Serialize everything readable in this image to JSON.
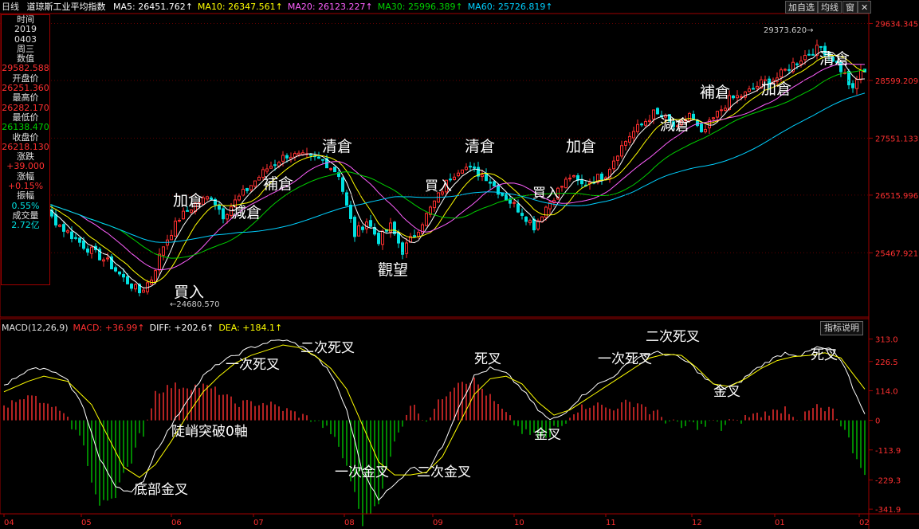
{
  "header": {
    "period": "日线",
    "index_name": "道琼斯工业平均指数",
    "ma": [
      {
        "label": "MA5: 26451.762↑",
        "color": "#ffffff"
      },
      {
        "label": "MA10: 26347.561↑",
        "color": "#ffff00"
      },
      {
        "label": "MA20: 26123.227↑",
        "color": "#ff60ff"
      },
      {
        "label": "MA30: 25996.389↑",
        "color": "#00d000"
      },
      {
        "label": "MA60: 25726.819↑",
        "color": "#00d0ff"
      }
    ],
    "buttons": [
      "加自选",
      "均线",
      "窗",
      "✕"
    ]
  },
  "info_panel": [
    {
      "text": "时间",
      "cls": "w"
    },
    {
      "text": "2019",
      "cls": "w"
    },
    {
      "text": "0403",
      "cls": "w"
    },
    {
      "text": "周三",
      "cls": "w"
    },
    {
      "text": "数值",
      "cls": "w"
    },
    {
      "text": "29582.588",
      "cls": "r"
    },
    {
      "text": "开盘价",
      "cls": "w"
    },
    {
      "text": "26251.360",
      "cls": "r"
    },
    {
      "text": "最高价",
      "cls": "w"
    },
    {
      "text": "26282.170",
      "cls": "r"
    },
    {
      "text": "最低价",
      "cls": "w"
    },
    {
      "text": "26138.470",
      "cls": "g"
    },
    {
      "text": "收盘价",
      "cls": "w"
    },
    {
      "text": "26218.130",
      "cls": "r"
    },
    {
      "text": "涨跌",
      "cls": "w"
    },
    {
      "text": "+39.000",
      "cls": "r"
    },
    {
      "text": "涨幅",
      "cls": "w"
    },
    {
      "text": "+0.15%",
      "cls": "r"
    },
    {
      "text": "振幅",
      "cls": "w"
    },
    {
      "text": "0.55%",
      "cls": "c"
    },
    {
      "text": "成交量",
      "cls": "w"
    },
    {
      "text": "2.72亿",
      "cls": "c"
    }
  ],
  "macd_header": [
    {
      "label": "MACD(12,26,9)",
      "color": "#e0e0e0"
    },
    {
      "label": "MACD: +36.99↑",
      "color": "#ff3030"
    },
    {
      "label": "DIFF: +202.6↑",
      "color": "#ffffff"
    },
    {
      "label": "DEA: +184.1↑",
      "color": "#ffff00"
    }
  ],
  "macd_button": "指标说明",
  "chart_data": [
    {
      "type": "candlestick",
      "y_ticks": [
        29634.345,
        28599.209,
        27551.133,
        26515.996,
        25467.921
      ],
      "ylim": [
        24300,
        29800
      ],
      "x_month_labels": [
        "04",
        "05",
        "06",
        "07",
        "08",
        "09",
        "10",
        "11",
        "12",
        "01",
        "02"
      ],
      "price_anchors": [
        [
          0,
          26500
        ],
        [
          10,
          26250
        ],
        [
          15,
          25900
        ],
        [
          20,
          25600
        ],
        [
          26,
          25300
        ],
        [
          30,
          25000
        ],
        [
          34,
          24750
        ],
        [
          37,
          25000
        ],
        [
          40,
          25600
        ],
        [
          44,
          26100
        ],
        [
          48,
          26350
        ],
        [
          52,
          26500
        ],
        [
          55,
          26150
        ],
        [
          58,
          26400
        ],
        [
          62,
          26700
        ],
        [
          66,
          27000
        ],
        [
          71,
          27250
        ],
        [
          76,
          27200
        ],
        [
          80,
          27150
        ],
        [
          84,
          26900
        ],
        [
          86,
          26300
        ],
        [
          88,
          25800
        ],
        [
          91,
          26050
        ],
        [
          94,
          25700
        ],
        [
          97,
          25950
        ],
        [
          100,
          25500
        ],
        [
          103,
          25800
        ],
        [
          106,
          26150
        ],
        [
          109,
          26500
        ],
        [
          112,
          26850
        ],
        [
          115,
          27050
        ],
        [
          118,
          26950
        ],
        [
          121,
          26850
        ],
        [
          124,
          26600
        ],
        [
          127,
          26400
        ],
        [
          130,
          26200
        ],
        [
          133,
          25950
        ],
        [
          136,
          26300
        ],
        [
          139,
          26600
        ],
        [
          142,
          26850
        ],
        [
          145,
          26700
        ],
        [
          148,
          26800
        ],
        [
          151,
          26900
        ],
        [
          154,
          27300
        ],
        [
          157,
          27600
        ],
        [
          160,
          27800
        ],
        [
          163,
          28000
        ],
        [
          166,
          27900
        ],
        [
          169,
          27700
        ],
        [
          172,
          28000
        ],
        [
          175,
          27600
        ],
        [
          178,
          27900
        ],
        [
          182,
          28250
        ],
        [
          186,
          28350
        ],
        [
          190,
          28550
        ],
        [
          194,
          28650
        ],
        [
          198,
          28900
        ],
        [
          202,
          29100
        ],
        [
          205,
          29200
        ],
        [
          208,
          29000
        ],
        [
          211,
          28700
        ],
        [
          213,
          28400
        ],
        [
          215,
          28800
        ],
        [
          216,
          28700
        ]
      ],
      "annotations": [
        {
          "text": "加倉",
          "x": 217,
          "y": 258,
          "size": 19
        },
        {
          "text": "減倉",
          "x": 290,
          "y": 273,
          "size": 19
        },
        {
          "text": "補倉",
          "x": 330,
          "y": 237,
          "size": 19
        },
        {
          "text": "清倉",
          "x": 404,
          "y": 190,
          "size": 19
        },
        {
          "text": "買入",
          "x": 533,
          "y": 239,
          "size": 17
        },
        {
          "text": "觀望",
          "x": 474,
          "y": 345,
          "size": 19
        },
        {
          "text": "清倉",
          "x": 583,
          "y": 190,
          "size": 19
        },
        {
          "text": "加倉",
          "x": 710,
          "y": 190,
          "size": 19
        },
        {
          "text": "買入",
          "x": 668,
          "y": 248,
          "size": 17
        },
        {
          "text": "補倉",
          "x": 878,
          "y": 122,
          "size": 19
        },
        {
          "text": "減倉",
          "x": 828,
          "y": 163,
          "size": 19
        },
        {
          "text": "加倉",
          "x": 955,
          "y": 118,
          "size": 19
        },
        {
          "text": "清倉",
          "x": 1028,
          "y": 80,
          "size": 19
        },
        {
          "text": "買入",
          "x": 218,
          "y": 373,
          "size": 19
        }
      ],
      "peak_label": "29373.620",
      "trough_label": "24680.570"
    },
    {
      "type": "macd",
      "y_ticks": [
        "313.0",
        "226.5",
        "114.0",
        "0",
        "-113.9",
        "-229.3",
        "-341.9"
      ],
      "y_tick_values": [
        313.0,
        226.5,
        114.0,
        0,
        -113.9,
        -229.3,
        -341.9
      ],
      "ylim": [
        -360,
        330
      ],
      "diff_anchors": [
        [
          0,
          130
        ],
        [
          4,
          180
        ],
        [
          8,
          200
        ],
        [
          12,
          190
        ],
        [
          16,
          150
        ],
        [
          20,
          50
        ],
        [
          24,
          -150
        ],
        [
          28,
          -250
        ],
        [
          32,
          -280
        ],
        [
          35,
          -230
        ],
        [
          38,
          -120
        ],
        [
          42,
          -20
        ],
        [
          46,
          80
        ],
        [
          50,
          170
        ],
        [
          54,
          220
        ],
        [
          58,
          250
        ],
        [
          62,
          280
        ],
        [
          66,
          300
        ],
        [
          70,
          310
        ],
        [
          74,
          290
        ],
        [
          78,
          250
        ],
        [
          82,
          180
        ],
        [
          86,
          40
        ],
        [
          90,
          -200
        ],
        [
          94,
          -300
        ],
        [
          98,
          -250
        ],
        [
          102,
          -180
        ],
        [
          106,
          -200
        ],
        [
          110,
          -100
        ],
        [
          114,
          50
        ],
        [
          118,
          170
        ],
        [
          122,
          200
        ],
        [
          126,
          180
        ],
        [
          130,
          120
        ],
        [
          134,
          40
        ],
        [
          137,
          0
        ],
        [
          140,
          20
        ],
        [
          144,
          80
        ],
        [
          148,
          130
        ],
        [
          152,
          160
        ],
        [
          156,
          210
        ],
        [
          160,
          250
        ],
        [
          164,
          260
        ],
        [
          168,
          250
        ],
        [
          172,
          220
        ],
        [
          176,
          160
        ],
        [
          180,
          120
        ],
        [
          184,
          140
        ],
        [
          188,
          190
        ],
        [
          192,
          230
        ],
        [
          196,
          260
        ],
        [
          200,
          250
        ],
        [
          204,
          280
        ],
        [
          208,
          270
        ],
        [
          211,
          200
        ],
        [
          214,
          90
        ],
        [
          216,
          30
        ]
      ],
      "dea_anchors": [
        [
          0,
          110
        ],
        [
          6,
          150
        ],
        [
          10,
          170
        ],
        [
          16,
          150
        ],
        [
          22,
          60
        ],
        [
          26,
          -60
        ],
        [
          30,
          -180
        ],
        [
          34,
          -220
        ],
        [
          38,
          -170
        ],
        [
          42,
          -80
        ],
        [
          46,
          20
        ],
        [
          50,
          110
        ],
        [
          54,
          170
        ],
        [
          58,
          220
        ],
        [
          62,
          250
        ],
        [
          66,
          270
        ],
        [
          70,
          290
        ],
        [
          74,
          280
        ],
        [
          78,
          250
        ],
        [
          82,
          200
        ],
        [
          86,
          120
        ],
        [
          90,
          -20
        ],
        [
          94,
          -160
        ],
        [
          98,
          -210
        ],
        [
          102,
          -210
        ],
        [
          106,
          -200
        ],
        [
          110,
          -140
        ],
        [
          114,
          -20
        ],
        [
          118,
          100
        ],
        [
          122,
          160
        ],
        [
          126,
          170
        ],
        [
          130,
          140
        ],
        [
          134,
          70
        ],
        [
          138,
          20
        ],
        [
          142,
          40
        ],
        [
          146,
          80
        ],
        [
          150,
          120
        ],
        [
          154,
          160
        ],
        [
          158,
          200
        ],
        [
          162,
          240
        ],
        [
          166,
          255
        ],
        [
          170,
          250
        ],
        [
          174,
          200
        ],
        [
          178,
          140
        ],
        [
          182,
          130
        ],
        [
          186,
          160
        ],
        [
          190,
          200
        ],
        [
          194,
          230
        ],
        [
          198,
          245
        ],
        [
          202,
          250
        ],
        [
          206,
          260
        ],
        [
          210,
          240
        ],
        [
          213,
          180
        ],
        [
          216,
          120
        ]
      ],
      "annotations": [
        {
          "text": "一次死叉",
          "x": 283,
          "y": 463,
          "size": 17
        },
        {
          "text": "二次死叉",
          "x": 377,
          "y": 442,
          "size": 17
        },
        {
          "text": "陡峭突破0軸",
          "x": 215,
          "y": 547,
          "size": 17
        },
        {
          "text": "底部金叉",
          "x": 168,
          "y": 620,
          "size": 17
        },
        {
          "text": "一次金叉",
          "x": 420,
          "y": 598,
          "size": 17
        },
        {
          "text": "二次金叉",
          "x": 523,
          "y": 598,
          "size": 17
        },
        {
          "text": "死叉",
          "x": 595,
          "y": 456,
          "size": 17
        },
        {
          "text": "金叉",
          "x": 670,
          "y": 551,
          "size": 17
        },
        {
          "text": "一次死叉",
          "x": 750,
          "y": 456,
          "size": 17
        },
        {
          "text": "二次死叉",
          "x": 810,
          "y": 428,
          "size": 17
        },
        {
          "text": "金叉",
          "x": 895,
          "y": 497,
          "size": 17
        },
        {
          "text": "死叉",
          "x": 1017,
          "y": 451,
          "size": 17
        }
      ]
    }
  ]
}
